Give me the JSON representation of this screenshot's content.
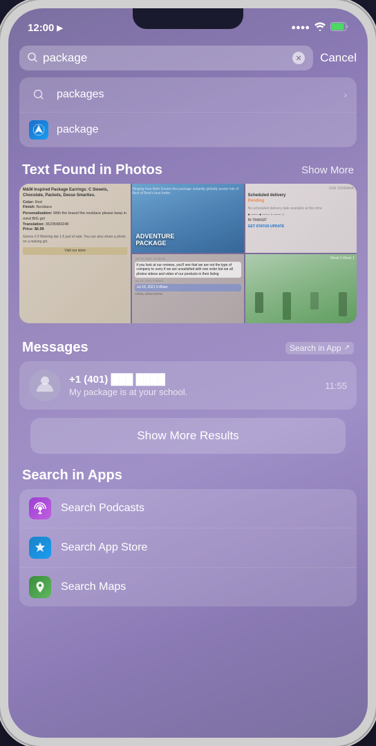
{
  "statusBar": {
    "time": "12:00",
    "batteryIcon": "🔋",
    "wifiIcon": "wifi",
    "locationIcon": "▶"
  },
  "searchBar": {
    "query": "package",
    "cancelLabel": "Cancel",
    "placeholder": "Search"
  },
  "suggestions": [
    {
      "id": "packages",
      "label": "packages",
      "icon": "search",
      "showArrow": true
    },
    {
      "id": "package",
      "label": "package",
      "icon": "safari",
      "showArrow": false
    }
  ],
  "textFoundInPhotos": {
    "sectionTitle": "Text Found in Photos",
    "actionLabel": "Show More"
  },
  "messages": {
    "sectionTitle": "Messages",
    "actionLabel": "Search in App",
    "contact": "+1 (401) ███ ████",
    "preview": "My package is at your school.",
    "time": "11:55"
  },
  "showMoreResults": {
    "label": "Show More Results"
  },
  "searchInApps": {
    "sectionTitle": "Search in Apps",
    "apps": [
      {
        "id": "podcasts",
        "label": "Search Podcasts",
        "iconType": "podcasts"
      },
      {
        "id": "appstore",
        "label": "Search App Store",
        "iconType": "appstore"
      },
      {
        "id": "maps",
        "label": "Search Maps",
        "iconType": "maps"
      }
    ]
  }
}
